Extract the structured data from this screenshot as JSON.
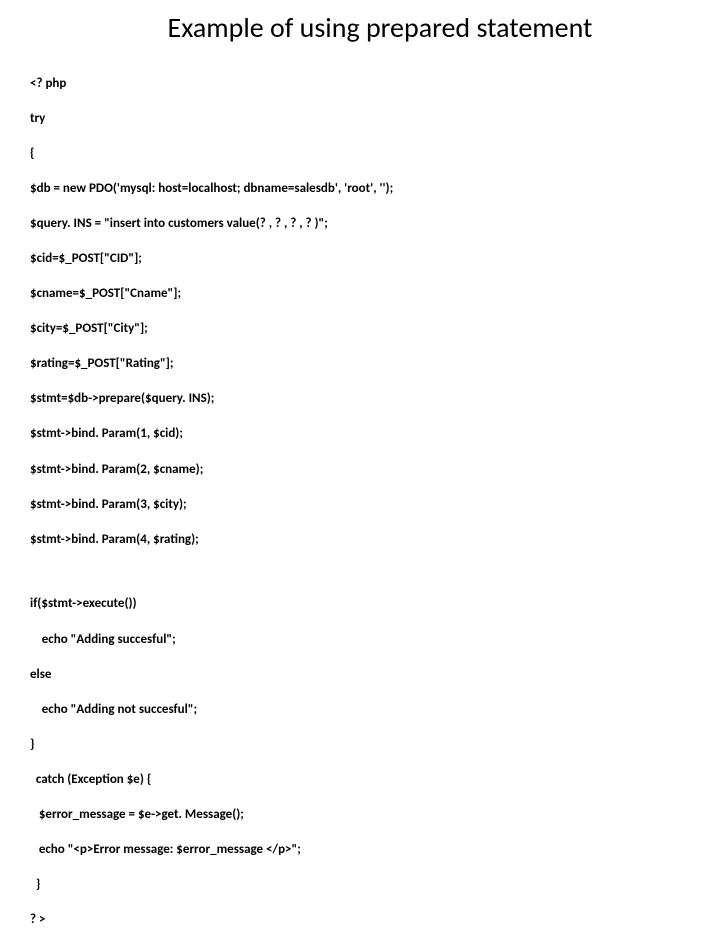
{
  "title": "Example of using prepared statement",
  "code": {
    "lines": [
      "<? php",
      "try",
      "{",
      "$db = new PDO('mysql: host=localhost; dbname=salesdb', 'root', '');",
      "$query. INS = \"insert into customers value(? , ? , ? , ? )\";",
      "$cid=$_POST[\"CID\"];",
      "$cname=$_POST[\"Cname\"];",
      "$city=$_POST[\"City\"];",
      "$rating=$_POST[\"Rating\"];",
      "$stmt=$db->prepare($query. INS);",
      "$stmt->bind. Param(1, $cid);",
      "$stmt->bind. Param(2, $cname);",
      "$stmt->bind. Param(3, $city);",
      "$stmt->bind. Param(4, $rating);"
    ],
    "lines2": [
      "if($stmt->execute())",
      "    echo \"Adding succesful\";",
      "else",
      "    echo \"Adding not succesful\";",
      "}",
      "  catch (Exception $e) {",
      "   $error_message = $e->get. Message();",
      "   echo \"<p>Error message: $error_message </p>\";",
      "  }",
      "? >"
    ]
  }
}
